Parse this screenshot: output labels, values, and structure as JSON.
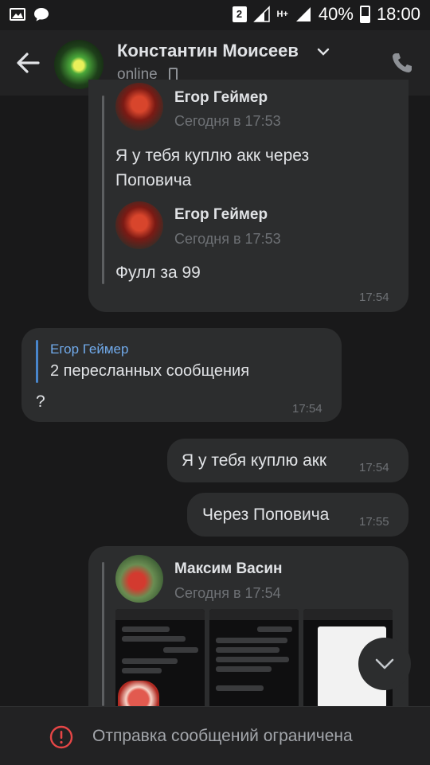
{
  "status_bar": {
    "sim": "2",
    "network": "H+",
    "battery": "40%",
    "time": "18:00"
  },
  "header": {
    "name": "Константин Моисеев",
    "status": "online"
  },
  "messages": {
    "m1": {
      "fwd1_name": "Егор Геймер",
      "fwd1_date": "Сегодня в 17:53",
      "fwd1_text": "Я у тебя куплю акк через Поповича",
      "fwd2_name": "Егор Геймер",
      "fwd2_date": "Сегодня в 17:53",
      "fwd2_text": "Фулл за 99",
      "time": "17:54"
    },
    "m2": {
      "reply_name": "Егор Геймер",
      "reply_text": "2 пересланных сообщения",
      "text": "?",
      "time": "17:54"
    },
    "m3": {
      "text": "Я у тебя куплю акк",
      "time": "17:54"
    },
    "m4": {
      "text": "Через Поповича",
      "time": "17:55"
    },
    "m5": {
      "fwd_name": "Максим Васин",
      "fwd_date": "Сегодня в 17:54"
    }
  },
  "footer": {
    "text": "Отправка сообщений ограничена"
  },
  "colors": {
    "background": "#19191a",
    "bubble": "#2c2d2e",
    "accent": "#71aaeb",
    "warning": "#e64646"
  }
}
